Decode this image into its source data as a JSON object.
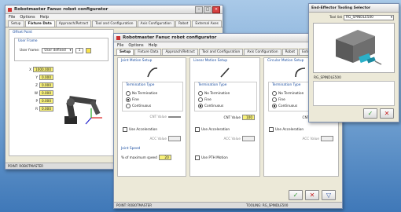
{
  "win1": {
    "title": "Robotmaster Fanuc robot configurator",
    "menu": [
      "File",
      "Options",
      "Help"
    ],
    "tabs": [
      "Setup",
      "Fixture Data",
      "Approach/Retract",
      "Tool and Configuration",
      "Axis Configuration",
      "Robot",
      "External Axes"
    ],
    "active_tab": 1,
    "group_title": "Offset Point",
    "subgroup_title": "User Frame",
    "frame_label": "User frame:",
    "frame_value": "User defined",
    "frame_num": "1",
    "rows": [
      {
        "label": "X",
        "value": "1000.000"
      },
      {
        "label": "Y",
        "value": "0.000"
      },
      {
        "label": "Z",
        "value": "0.000"
      },
      {
        "label": "W",
        "value": "0.000"
      },
      {
        "label": "P",
        "value": "0.000"
      },
      {
        "label": "R",
        "value": "0.000"
      }
    ],
    "status": "POINT: ROBOTMASTER"
  },
  "win2": {
    "title": "Robotmaster Fanuc robot configurator",
    "menu": [
      "File",
      "Options",
      "Help"
    ],
    "tabs": [
      "Setup",
      "Fixture Data",
      "Approach/Retract",
      "Tool and Configuration",
      "Axis Configuration",
      "Robot",
      "External Axes"
    ],
    "active_tab": 0,
    "col_groups": [
      "Joint Motion Setup",
      "Linear Motion Setup",
      "Circular Motion Setup"
    ],
    "term_title": "Termination Type",
    "opts": [
      "No Termination",
      "Fine",
      "Continuous"
    ],
    "cnt_label": "CNT Value",
    "cnt_values": [
      "",
      "100",
      "100"
    ],
    "accel_label": "Use Acceleration",
    "acc_label": "ACC Value",
    "speed_group": "Joint Speed",
    "speed_label": "% of maximum speed",
    "speed_value": "20",
    "pth_label": "Use PTH Motion",
    "status_left": "POINT: ROBOTMASTER",
    "status_right": "TOOLING: RG_SPINDLE500"
  },
  "win3": {
    "title": "End-Effector Tooling Selector",
    "tool_label": "Tool list",
    "tool_value": "RG_SPINDLE500",
    "tool_name": "RG_SPINDLE500"
  }
}
